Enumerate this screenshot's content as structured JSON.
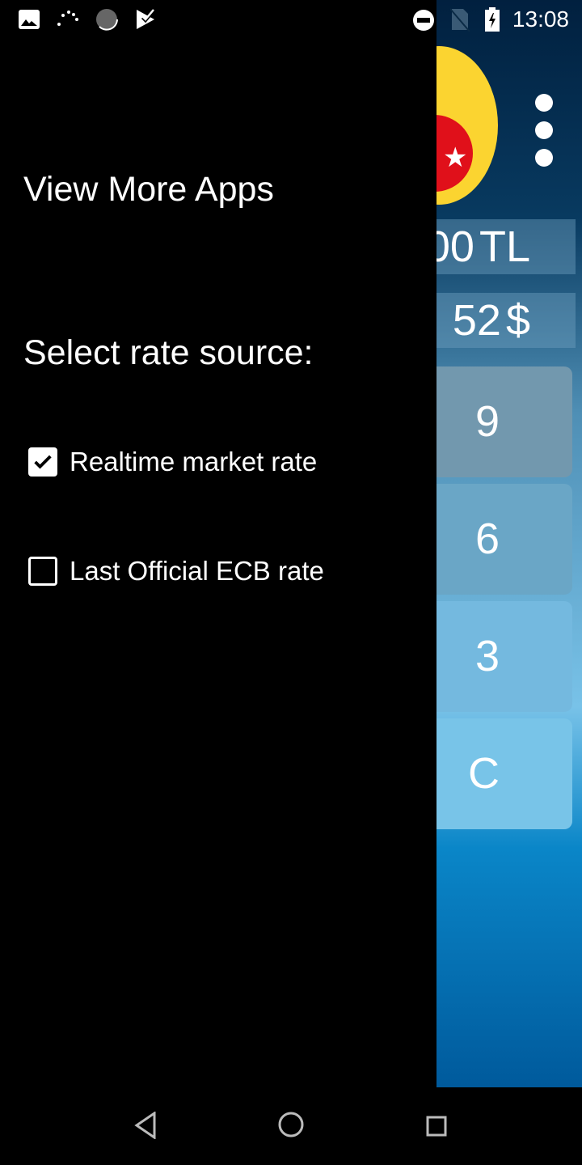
{
  "status_bar": {
    "time": "13:08",
    "icons": [
      "image-icon",
      "loading-dots-icon",
      "progress-circle-icon",
      "play-store-check-icon",
      "do-not-disturb-icon",
      "no-sim-icon",
      "battery-charging-icon"
    ]
  },
  "app": {
    "display_1": {
      "value": "00",
      "unit": "TL"
    },
    "display_2": {
      "value": "52",
      "unit": "$"
    },
    "keys": [
      "9",
      "6",
      "3",
      "C"
    ],
    "key_colors": [
      "#7298ae",
      "#6aa6c6",
      "#74b9df",
      "#78c4e8"
    ]
  },
  "drawer": {
    "view_more_apps": "View More Apps",
    "select_rate_source": "Select rate source:",
    "options": [
      {
        "label": "Realtime market rate",
        "checked": true
      },
      {
        "label": "Last Official ECB rate",
        "checked": false
      }
    ]
  },
  "nav_bar": {
    "icons": [
      "back-icon",
      "home-icon",
      "recents-icon"
    ]
  }
}
